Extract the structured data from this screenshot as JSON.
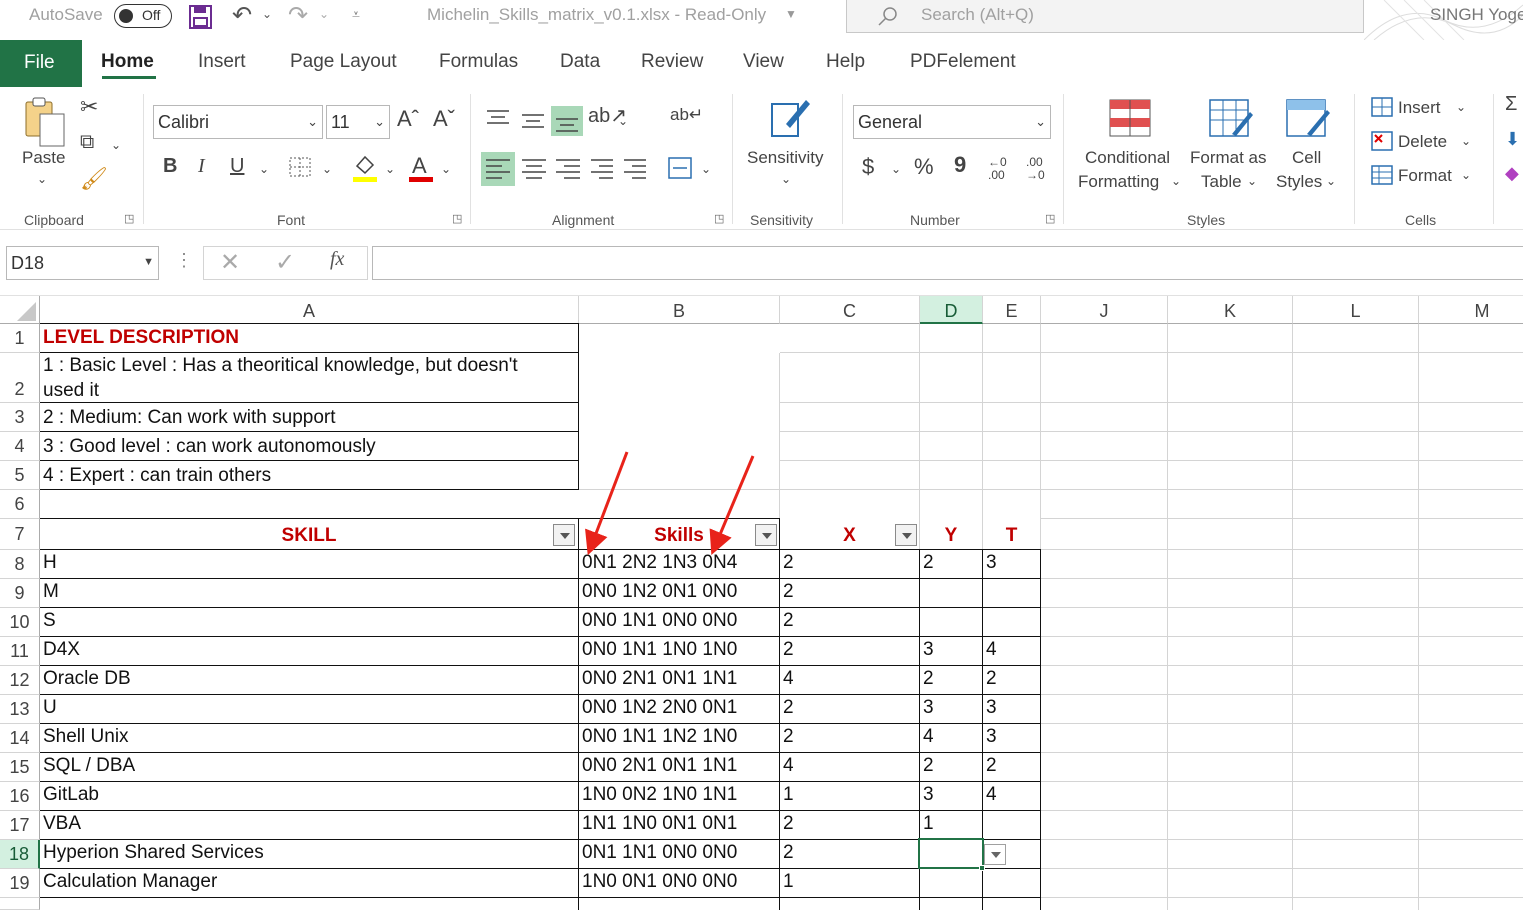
{
  "titlebar": {
    "autosave_label": "AutoSave",
    "autosave_state": "Off",
    "filename": "Michelin_Skills_matrix_v0.1.xlsx  -  Read-Only",
    "search_placeholder": "Search (Alt+Q)",
    "user": "SINGH Yoge"
  },
  "tabs": [
    "File",
    "Home",
    "Insert",
    "Page Layout",
    "Formulas",
    "Data",
    "Review",
    "View",
    "Help",
    "PDFelement"
  ],
  "ribbon": {
    "clipboard": {
      "paste": "Paste",
      "group": "Clipboard"
    },
    "font": {
      "name": "Calibri",
      "size": "11",
      "group": "Font"
    },
    "alignment": {
      "group": "Alignment"
    },
    "sensitivity": {
      "label": "Sensitivity",
      "group": "Sensitivity"
    },
    "number": {
      "format": "General",
      "group": "Number",
      "currency": "$",
      "percent": "%",
      "comma": "9"
    },
    "styles": {
      "conditional": "Conditional",
      "formatting": "Formatting",
      "format_as": "Format as",
      "table": "Table",
      "cell": "Cell",
      "cell_styles": "Styles",
      "group": "Styles"
    },
    "cells": {
      "insert": "Insert",
      "delete": "Delete",
      "format": "Format",
      "group": "Cells"
    }
  },
  "formula_bar": {
    "name_box": "D18",
    "fx": "fx",
    "content": ""
  },
  "columns": [
    "A",
    "B",
    "C",
    "D",
    "E",
    "J",
    "K",
    "L",
    "M"
  ],
  "rows": [
    "1",
    "2",
    "3",
    "4",
    "5",
    "6",
    "7",
    "8",
    "9",
    "10",
    "11",
    "12",
    "13",
    "14",
    "15",
    "16",
    "17",
    "18",
    "19"
  ],
  "sheet": {
    "level_title": "LEVEL DESCRIPTION",
    "level_1a": "1 : Basic Level : Has a theoritical knowledge, but doesn't",
    "level_1b": "used it",
    "level_2": "2 : Medium: Can work with support",
    "level_3": "3 : Good level : can work autonomously",
    "level_4": "4 : Expert : can train others",
    "header_skill": "SKILL",
    "header_skills": "Skills",
    "header_x": "X",
    "header_y": "Y",
    "header_t": "T",
    "data_rows": [
      [
        "H",
        "0N1 2N2 1N3 0N4",
        "2",
        "2",
        "3"
      ],
      [
        "M",
        "0N0 1N2 0N1 0N0",
        "2",
        "",
        ""
      ],
      [
        "S",
        "0N0 1N1 0N0 0N0",
        "2",
        "",
        ""
      ],
      [
        "D4X",
        "0N0 1N1 1N0 1N0",
        "2",
        "3",
        "4"
      ],
      [
        "Oracle DB",
        "0N0 2N1 0N1 1N1",
        "4",
        "2",
        "2"
      ],
      [
        "U",
        "0N0 1N2 2N0 0N1",
        "2",
        "3",
        "3"
      ],
      [
        "Shell Unix",
        "0N0 1N1 1N2 1N0",
        "2",
        "4",
        "3"
      ],
      [
        "SQL / DBA",
        "0N0 2N1 0N1 1N1",
        "4",
        "2",
        "2"
      ],
      [
        "GitLab",
        "1N0 0N2 1N0 1N1",
        "1",
        "3",
        "4"
      ],
      [
        "VBA",
        "1N1 1N0 0N1 0N1",
        "2",
        "1",
        ""
      ],
      [
        "Hyperion Shared Services",
        "0N1 1N1 0N0 0N0",
        "2",
        "",
        ""
      ],
      [
        "Calculation Manager",
        "1N0 0N1 0N0 0N0",
        "1",
        "",
        ""
      ]
    ]
  },
  "colors": {
    "excel_green": "#217346",
    "header_red": "#c00000",
    "arrow_red": "#e8231a"
  }
}
